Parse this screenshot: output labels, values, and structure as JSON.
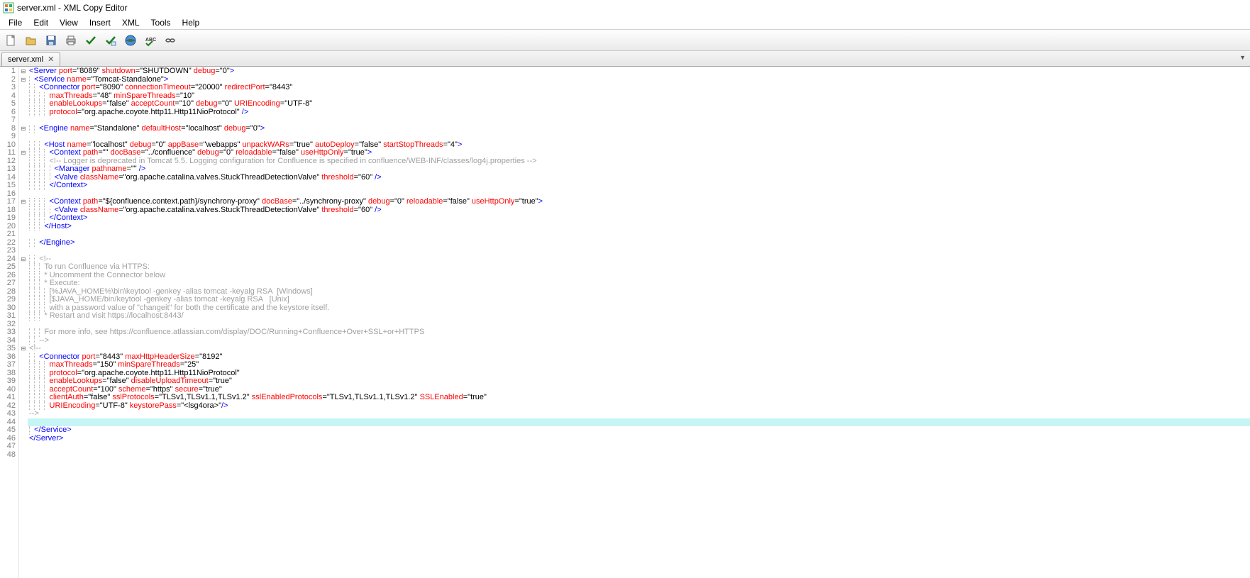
{
  "title": "server.xml - XML Copy Editor",
  "menus": [
    "File",
    "Edit",
    "View",
    "Insert",
    "XML",
    "Tools",
    "Help"
  ],
  "tab": {
    "label": "server.xml"
  },
  "line_count": 48,
  "fold_marks": {
    "1": "⊟",
    "2": "⊟",
    "8": "⊟",
    "11": "⊟",
    "17": "⊟",
    "24": "⊟",
    "35": "⊟"
  },
  "current_line": 44,
  "code": [
    {
      "n": 1,
      "ind": 0,
      "seg": [
        {
          "t": "<Server ",
          "c": "tag"
        },
        {
          "t": "port",
          "c": "attr"
        },
        {
          "t": "=\"8089\" ",
          "c": "val"
        },
        {
          "t": "shutdown",
          "c": "attr"
        },
        {
          "t": "=\"SHUTDOWN\" ",
          "c": "val"
        },
        {
          "t": "debug",
          "c": "attr"
        },
        {
          "t": "=\"0\"",
          "c": "val"
        },
        {
          "t": ">",
          "c": "tag"
        }
      ]
    },
    {
      "n": 2,
      "ind": 1,
      "seg": [
        {
          "t": "<Service ",
          "c": "tag"
        },
        {
          "t": "name",
          "c": "attr"
        },
        {
          "t": "=\"Tomcat-Standalone\"",
          "c": "val"
        },
        {
          "t": ">",
          "c": "tag"
        }
      ]
    },
    {
      "n": 3,
      "ind": 2,
      "seg": [
        {
          "t": "<Connector ",
          "c": "tag"
        },
        {
          "t": "port",
          "c": "attr"
        },
        {
          "t": "=\"8090\" ",
          "c": "val"
        },
        {
          "t": "connectionTimeout",
          "c": "attr"
        },
        {
          "t": "=\"20000\" ",
          "c": "val"
        },
        {
          "t": "redirectPort",
          "c": "attr"
        },
        {
          "t": "=\"8443\"",
          "c": "val"
        }
      ]
    },
    {
      "n": 4,
      "ind": 4,
      "seg": [
        {
          "t": "maxThreads",
          "c": "attr"
        },
        {
          "t": "=\"48\" ",
          "c": "val"
        },
        {
          "t": "minSpareThreads",
          "c": "attr"
        },
        {
          "t": "=\"10\"",
          "c": "val"
        }
      ]
    },
    {
      "n": 5,
      "ind": 4,
      "seg": [
        {
          "t": "enableLookups",
          "c": "attr"
        },
        {
          "t": "=\"false\" ",
          "c": "val"
        },
        {
          "t": "acceptCount",
          "c": "attr"
        },
        {
          "t": "=\"10\" ",
          "c": "val"
        },
        {
          "t": "debug",
          "c": "attr"
        },
        {
          "t": "=\"0\" ",
          "c": "val"
        },
        {
          "t": "URIEncoding",
          "c": "attr"
        },
        {
          "t": "=\"UTF-8\"",
          "c": "val"
        }
      ]
    },
    {
      "n": 6,
      "ind": 4,
      "seg": [
        {
          "t": "protocol",
          "c": "attr"
        },
        {
          "t": "=\"org.apache.coyote.http11.Http11NioProtocol\" ",
          "c": "val"
        },
        {
          "t": "/>",
          "c": "tag"
        }
      ]
    },
    {
      "n": 7,
      "ind": 0,
      "seg": []
    },
    {
      "n": 8,
      "ind": 2,
      "seg": [
        {
          "t": "<Engine ",
          "c": "tag"
        },
        {
          "t": "name",
          "c": "attr"
        },
        {
          "t": "=\"Standalone\" ",
          "c": "val"
        },
        {
          "t": "defaultHost",
          "c": "attr"
        },
        {
          "t": "=\"localhost\" ",
          "c": "val"
        },
        {
          "t": "debug",
          "c": "attr"
        },
        {
          "t": "=\"0\"",
          "c": "val"
        },
        {
          "t": ">",
          "c": "tag"
        }
      ]
    },
    {
      "n": 9,
      "ind": 0,
      "seg": []
    },
    {
      "n": 10,
      "ind": 3,
      "seg": [
        {
          "t": "<Host ",
          "c": "tag"
        },
        {
          "t": "name",
          "c": "attr"
        },
        {
          "t": "=\"localhost\" ",
          "c": "val"
        },
        {
          "t": "debug",
          "c": "attr"
        },
        {
          "t": "=\"0\" ",
          "c": "val"
        },
        {
          "t": "appBase",
          "c": "attr"
        },
        {
          "t": "=\"webapps\" ",
          "c": "val"
        },
        {
          "t": "unpackWARs",
          "c": "attr"
        },
        {
          "t": "=\"true\" ",
          "c": "val"
        },
        {
          "t": "autoDeploy",
          "c": "attr"
        },
        {
          "t": "=\"false\" ",
          "c": "val"
        },
        {
          "t": "startStopThreads",
          "c": "attr"
        },
        {
          "t": "=\"4\"",
          "c": "val"
        },
        {
          "t": ">",
          "c": "tag"
        }
      ]
    },
    {
      "n": 11,
      "ind": 4,
      "seg": [
        {
          "t": "<Context ",
          "c": "tag"
        },
        {
          "t": "path",
          "c": "attr"
        },
        {
          "t": "=\"\" ",
          "c": "val"
        },
        {
          "t": "docBase",
          "c": "attr"
        },
        {
          "t": "=\"../confluence\" ",
          "c": "val"
        },
        {
          "t": "debug",
          "c": "attr"
        },
        {
          "t": "=\"0\" ",
          "c": "val"
        },
        {
          "t": "reloadable",
          "c": "attr"
        },
        {
          "t": "=\"false\" ",
          "c": "val"
        },
        {
          "t": "useHttpOnly",
          "c": "attr"
        },
        {
          "t": "=\"true\"",
          "c": "val"
        },
        {
          "t": ">",
          "c": "tag"
        }
      ]
    },
    {
      "n": 12,
      "ind": 4,
      "seg": [
        {
          "t": "<!-- Logger is deprecated in Tomcat 5.5. Logging configuration for Confluence is specified in confluence/WEB-INF/classes/log4j.properties -->",
          "c": "comment"
        }
      ]
    },
    {
      "n": 13,
      "ind": 5,
      "seg": [
        {
          "t": "<Manager ",
          "c": "tag"
        },
        {
          "t": "pathname",
          "c": "attr"
        },
        {
          "t": "=\"\" ",
          "c": "val"
        },
        {
          "t": "/>",
          "c": "tag"
        }
      ]
    },
    {
      "n": 14,
      "ind": 5,
      "seg": [
        {
          "t": "<Valve ",
          "c": "tag"
        },
        {
          "t": "className",
          "c": "attr"
        },
        {
          "t": "=\"org.apache.catalina.valves.StuckThreadDetectionValve\" ",
          "c": "val"
        },
        {
          "t": "threshold",
          "c": "attr"
        },
        {
          "t": "=\"60\" ",
          "c": "val"
        },
        {
          "t": "/>",
          "c": "tag"
        }
      ]
    },
    {
      "n": 15,
      "ind": 4,
      "seg": [
        {
          "t": "</Context>",
          "c": "tag"
        }
      ]
    },
    {
      "n": 16,
      "ind": 0,
      "seg": []
    },
    {
      "n": 17,
      "ind": 4,
      "seg": [
        {
          "t": "<Context ",
          "c": "tag"
        },
        {
          "t": "path",
          "c": "attr"
        },
        {
          "t": "=\"${confluence.context.path}/synchrony-proxy\" ",
          "c": "val"
        },
        {
          "t": "docBase",
          "c": "attr"
        },
        {
          "t": "=\"../synchrony-proxy\" ",
          "c": "val"
        },
        {
          "t": "debug",
          "c": "attr"
        },
        {
          "t": "=\"0\" ",
          "c": "val"
        },
        {
          "t": "reloadable",
          "c": "attr"
        },
        {
          "t": "=\"false\" ",
          "c": "val"
        },
        {
          "t": "useHttpOnly",
          "c": "attr"
        },
        {
          "t": "=\"true\"",
          "c": "val"
        },
        {
          "t": ">",
          "c": "tag"
        }
      ]
    },
    {
      "n": 18,
      "ind": 5,
      "seg": [
        {
          "t": "<Valve ",
          "c": "tag"
        },
        {
          "t": "className",
          "c": "attr"
        },
        {
          "t": "=\"org.apache.catalina.valves.StuckThreadDetectionValve\" ",
          "c": "val"
        },
        {
          "t": "threshold",
          "c": "attr"
        },
        {
          "t": "=\"60\" ",
          "c": "val"
        },
        {
          "t": "/>",
          "c": "tag"
        }
      ]
    },
    {
      "n": 19,
      "ind": 4,
      "seg": [
        {
          "t": "</Context>",
          "c": "tag"
        }
      ]
    },
    {
      "n": 20,
      "ind": 3,
      "seg": [
        {
          "t": "</Host>",
          "c": "tag"
        }
      ]
    },
    {
      "n": 21,
      "ind": 0,
      "seg": []
    },
    {
      "n": 22,
      "ind": 2,
      "seg": [
        {
          "t": "</Engine>",
          "c": "tag"
        }
      ]
    },
    {
      "n": 23,
      "ind": 0,
      "seg": []
    },
    {
      "n": 24,
      "ind": 2,
      "seg": [
        {
          "t": "<!--",
          "c": "comment"
        }
      ]
    },
    {
      "n": 25,
      "ind": 3,
      "seg": [
        {
          "t": "To run Confluence via HTTPS:",
          "c": "comment"
        }
      ]
    },
    {
      "n": 26,
      "ind": 3,
      "seg": [
        {
          "t": "* Uncomment the Connector below",
          "c": "comment"
        }
      ]
    },
    {
      "n": 27,
      "ind": 3,
      "seg": [
        {
          "t": "* Execute:",
          "c": "comment"
        }
      ]
    },
    {
      "n": 28,
      "ind": 4,
      "seg": [
        {
          "t": "[%JAVA_HOME%\\bin\\keytool -genkey -alias tomcat -keyalg RSA  [Windows]",
          "c": "comment"
        }
      ]
    },
    {
      "n": 29,
      "ind": 4,
      "seg": [
        {
          "t": "[$JAVA_HOME/bin/keytool -genkey -alias tomcat -keyalg RSA   [Unix]",
          "c": "comment"
        }
      ]
    },
    {
      "n": 30,
      "ind": 4,
      "seg": [
        {
          "t": "with a password value of \"changeit\" for both the certificate and the keystore itself.",
          "c": "comment"
        }
      ]
    },
    {
      "n": 31,
      "ind": 3,
      "seg": [
        {
          "t": "* Restart and visit https://localhost:8443/",
          "c": "comment"
        }
      ]
    },
    {
      "n": 32,
      "ind": 0,
      "seg": []
    },
    {
      "n": 33,
      "ind": 3,
      "seg": [
        {
          "t": "For more info, see https://confluence.atlassian.com/display/DOC/Running+Confluence+Over+SSL+or+HTTPS",
          "c": "comment"
        }
      ]
    },
    {
      "n": 34,
      "ind": 2,
      "seg": [
        {
          "t": "-->",
          "c": "comment"
        }
      ]
    },
    {
      "n": 35,
      "ind": 0,
      "seg": [
        {
          "t": "<!--",
          "c": "comment"
        }
      ]
    },
    {
      "n": 36,
      "ind": 2,
      "seg": [
        {
          "t": "<Connector ",
          "c": "tag"
        },
        {
          "t": "port",
          "c": "attr"
        },
        {
          "t": "=\"8443\" ",
          "c": "val"
        },
        {
          "t": "maxHttpHeaderSize",
          "c": "attr"
        },
        {
          "t": "=\"8192\"",
          "c": "val"
        }
      ]
    },
    {
      "n": 37,
      "ind": 4,
      "seg": [
        {
          "t": "maxThreads",
          "c": "attr"
        },
        {
          "t": "=\"150\" ",
          "c": "val"
        },
        {
          "t": "minSpareThreads",
          "c": "attr"
        },
        {
          "t": "=\"25\"",
          "c": "val"
        }
      ]
    },
    {
      "n": 38,
      "ind": 4,
      "seg": [
        {
          "t": "protocol",
          "c": "attr"
        },
        {
          "t": "=\"org.apache.coyote.http11.Http11NioProtocol\"",
          "c": "val"
        }
      ]
    },
    {
      "n": 39,
      "ind": 4,
      "seg": [
        {
          "t": "enableLookups",
          "c": "attr"
        },
        {
          "t": "=\"false\" ",
          "c": "val"
        },
        {
          "t": "disableUploadTimeout",
          "c": "attr"
        },
        {
          "t": "=\"true\"",
          "c": "val"
        }
      ]
    },
    {
      "n": 40,
      "ind": 4,
      "seg": [
        {
          "t": "acceptCount",
          "c": "attr"
        },
        {
          "t": "=\"100\" ",
          "c": "val"
        },
        {
          "t": "scheme",
          "c": "attr"
        },
        {
          "t": "=\"https\" ",
          "c": "val"
        },
        {
          "t": "secure",
          "c": "attr"
        },
        {
          "t": "=\"true\"",
          "c": "val"
        }
      ]
    },
    {
      "n": 41,
      "ind": 4,
      "seg": [
        {
          "t": "clientAuth",
          "c": "attr"
        },
        {
          "t": "=\"false\" ",
          "c": "val"
        },
        {
          "t": "sslProtocols",
          "c": "attr"
        },
        {
          "t": "=\"TLSv1,TLSv1.1,TLSv1.2\" ",
          "c": "val"
        },
        {
          "t": "sslEnabledProtocols",
          "c": "attr"
        },
        {
          "t": "=\"TLSv1,TLSv1.1,TLSv1.2\" ",
          "c": "val"
        },
        {
          "t": "SSLEnabled",
          "c": "attr"
        },
        {
          "t": "=\"true\"",
          "c": "val"
        }
      ]
    },
    {
      "n": 42,
      "ind": 4,
      "seg": [
        {
          "t": "URIEncoding",
          "c": "attr"
        },
        {
          "t": "=\"UTF-8\" ",
          "c": "val"
        },
        {
          "t": "keystorePass",
          "c": "attr"
        },
        {
          "t": "=\"<lsg4ora>\"",
          "c": "val"
        },
        {
          "t": "/>",
          "c": "tag"
        }
      ]
    },
    {
      "n": 43,
      "ind": 0,
      "seg": [
        {
          "t": "-->",
          "c": "comment"
        }
      ]
    },
    {
      "n": 44,
      "ind": 0,
      "seg": []
    },
    {
      "n": 45,
      "ind": 1,
      "seg": [
        {
          "t": "</Service>",
          "c": "tag"
        }
      ]
    },
    {
      "n": 46,
      "ind": 0,
      "seg": [
        {
          "t": "</Server>",
          "c": "tag"
        }
      ]
    },
    {
      "n": 47,
      "ind": 0,
      "seg": []
    },
    {
      "n": 48,
      "ind": 0,
      "seg": []
    }
  ]
}
